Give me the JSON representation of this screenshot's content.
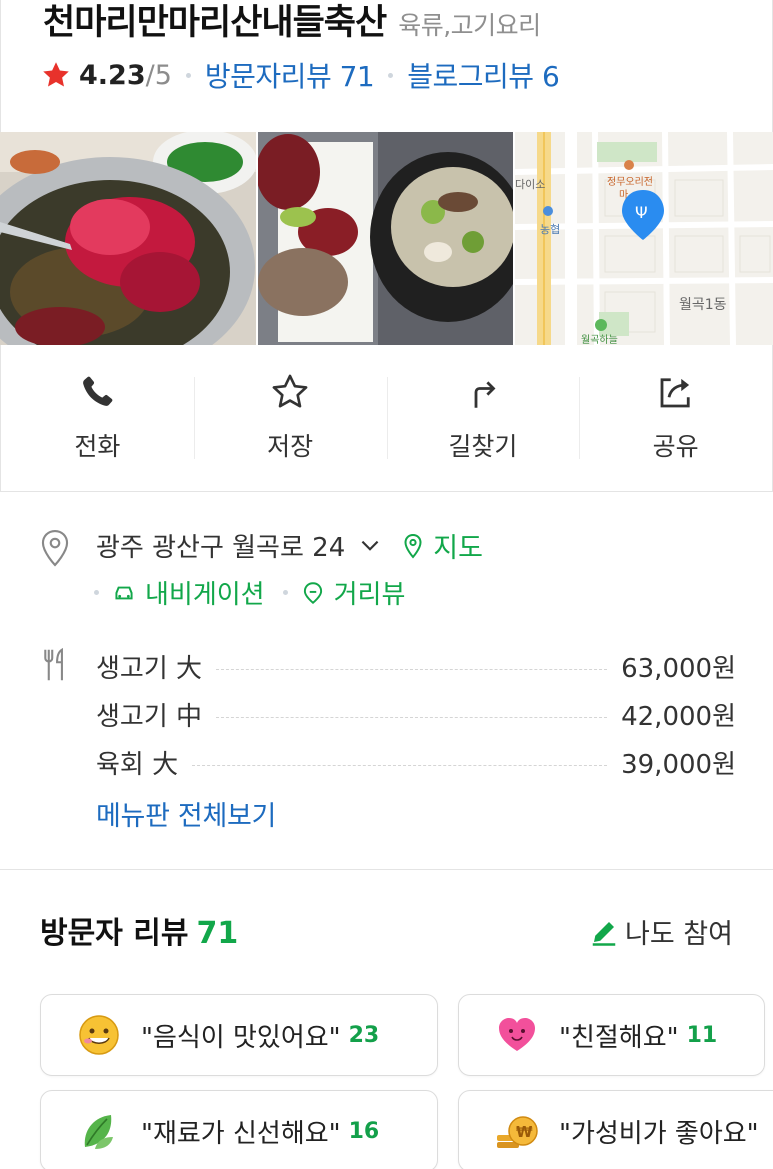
{
  "place": {
    "name": "천마리만마리산내들축산",
    "category": "육류,고기요리",
    "rating": "4.23",
    "rating_max": "/5",
    "visitor_reviews_label": "방문자리뷰 71",
    "blog_reviews_label": "블로그리뷰 6"
  },
  "map": {
    "labels": [
      "다이소",
      "정무오리전",
      "마",
      "농협",
      "월곡1동",
      "월곡하늘"
    ]
  },
  "actions": [
    {
      "label": "전화",
      "icon": "phone-icon"
    },
    {
      "label": "저장",
      "icon": "star-outline-icon"
    },
    {
      "label": "길찾기",
      "icon": "directions-icon"
    },
    {
      "label": "공유",
      "icon": "share-icon"
    }
  ],
  "info": {
    "address": "광주 광산구 월곡로 24",
    "map_link": "지도",
    "navigation_link": "내비게이션",
    "streetview_link": "거리뷰",
    "menu": [
      {
        "name": "생고기 大",
        "price": "63,000원"
      },
      {
        "name": "생고기 中",
        "price": "42,000원"
      },
      {
        "name": "육회 大",
        "price": "39,000원"
      }
    ],
    "menu_all_link": "메뉴판 전체보기"
  },
  "reviews": {
    "title": "방문자 리뷰",
    "count": "71",
    "participate_label": "나도 참여",
    "keywords": [
      {
        "text": "\"음식이 맛있어요\"",
        "count": "23",
        "icon": "smile-emoji-icon"
      },
      {
        "text": "\"친절해요\"",
        "count": "11",
        "icon": "heart-emoji-icon"
      },
      {
        "text": "\"재료가 신선해요\"",
        "count": "16",
        "icon": "leaf-emoji-icon"
      },
      {
        "text": "\"가성비가 좋아요\"",
        "count": "",
        "icon": "coin-emoji-icon"
      }
    ]
  },
  "colors": {
    "rating_star": "#e8322b",
    "link_blue": "#1d6bbf",
    "accent_green": "#12a74a"
  }
}
